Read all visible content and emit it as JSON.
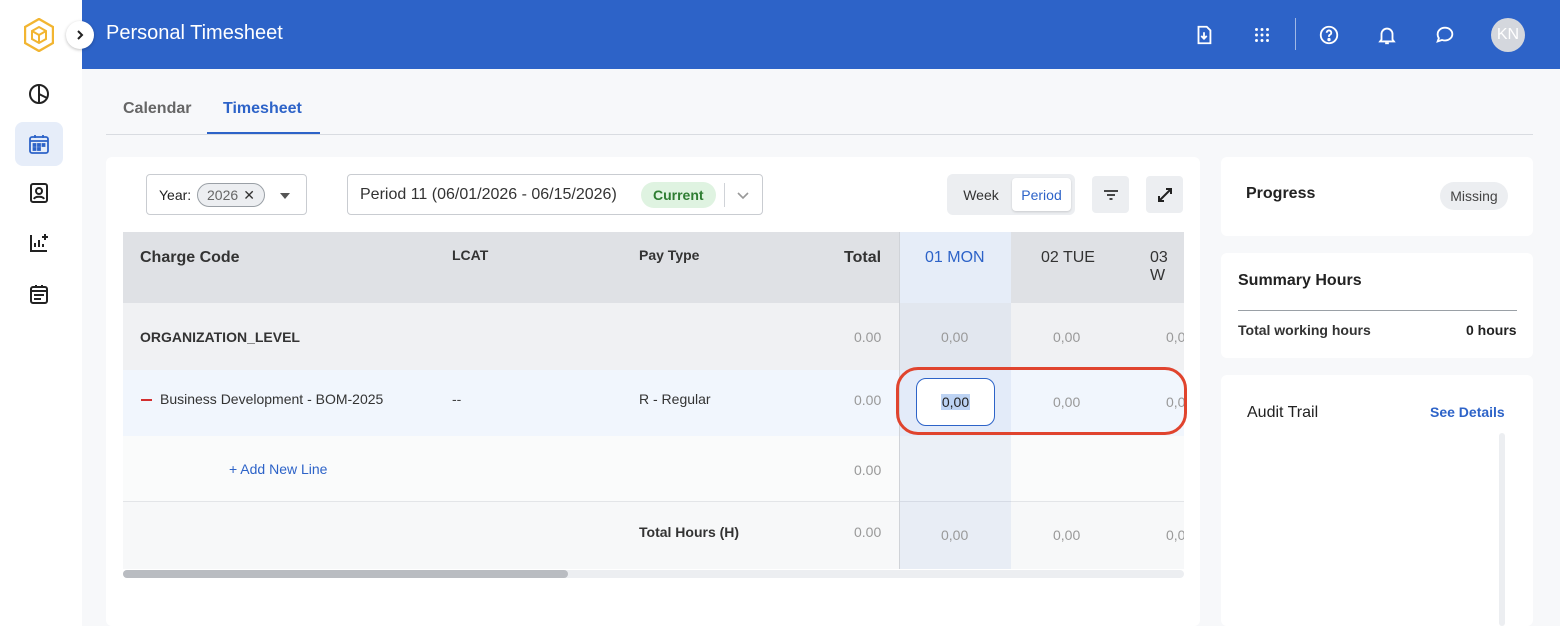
{
  "colors": {
    "brand_blue": "#2d63c8",
    "header_bg": "#2d63c8",
    "logo_gold": "#f2b531",
    "current_green": "#2e7d32",
    "error_red": "#e0442e"
  },
  "rail": {
    "items": [
      {
        "icon": "dashboard-pie-icon"
      },
      {
        "icon": "calendar-icon"
      },
      {
        "icon": "contact-card-icon"
      },
      {
        "icon": "chart-add-icon"
      },
      {
        "icon": "schedule-icon"
      }
    ]
  },
  "header": {
    "title": "Personal Timesheet",
    "avatar_initials": "KN",
    "icons": [
      "download-doc-icon",
      "apps-grid-icon",
      "help-icon",
      "bell-icon",
      "chat-icon"
    ]
  },
  "tabs": [
    {
      "label": "Calendar"
    },
    {
      "label": "Timesheet"
    }
  ],
  "filters": {
    "year_label": "Year:",
    "year_value": "2026",
    "year_clear": "✕",
    "period_value": "Period 11 (06/01/2026 - 06/15/2026)",
    "period_badge": "Current",
    "view_week": "Week",
    "view_period": "Period"
  },
  "table": {
    "headers": {
      "charge_code": "Charge Code",
      "lcat": "LCAT",
      "pay_type": "Pay Type",
      "total": "Total",
      "day1": "01 MON",
      "day2": "02 TUE",
      "day3": "03 W"
    },
    "org_row": {
      "name": "ORGANIZATION_LEVEL",
      "total": "0.00",
      "day1": "0,00",
      "day2": "0,00",
      "day3": "0,0"
    },
    "line_row": {
      "charge_code": "Business Development - BOM-2025",
      "lcat": "--",
      "pay_type": "R - Regular",
      "total": "0.00",
      "day1": "0,00",
      "day2": "0,00",
      "day3": "0,0"
    },
    "add_row": {
      "label": "+ Add New Line",
      "total": "0.00"
    },
    "total_row": {
      "label": "Total Hours (H)",
      "total": "0.00",
      "day1": "0,00",
      "day2": "0,00",
      "day3": "0,0"
    }
  },
  "progress": {
    "title": "Progress",
    "status": "Missing"
  },
  "summary": {
    "title": "Summary Hours",
    "row_label": "Total working hours",
    "row_value": "0 hours"
  },
  "audit": {
    "title": "Audit Trail",
    "link": "See Details"
  }
}
